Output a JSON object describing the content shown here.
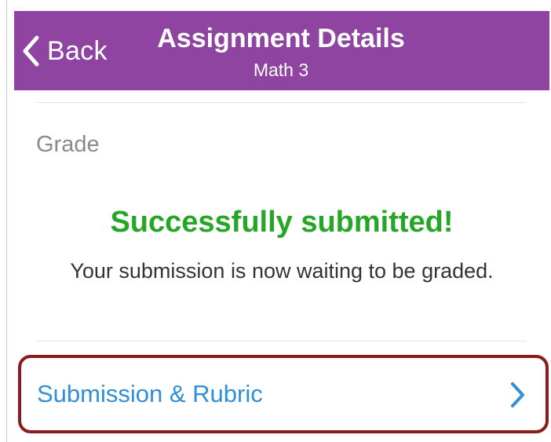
{
  "navbar": {
    "back_label": "Back",
    "title": "Assignment Details",
    "subtitle": "Math 3",
    "background_color": "#8e44a0",
    "back_icon": "chevron-left-icon"
  },
  "grade": {
    "label": "Grade"
  },
  "submission_status": {
    "headline": "Successfully submitted!",
    "message": "Your submission is now waiting to be graded.",
    "headline_color": "#26a626"
  },
  "submission_rubric": {
    "label": "Submission & Rubric",
    "icon": "chevron-right-icon",
    "label_color": "#2f8fd8",
    "highlight_color": "#8b1a1a"
  }
}
